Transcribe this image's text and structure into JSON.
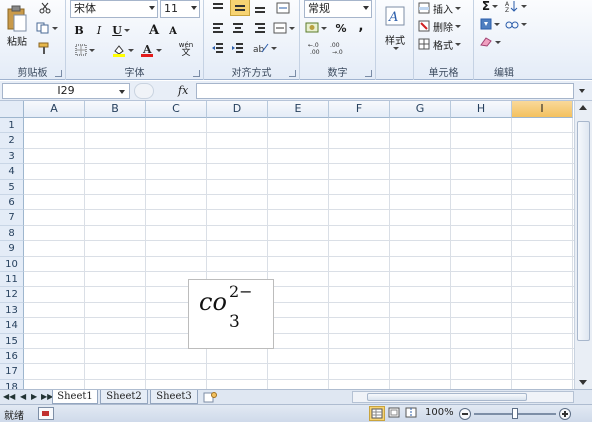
{
  "ribbon": {
    "clipboard": {
      "paste_label": "粘贴",
      "group_label": "剪贴板"
    },
    "font": {
      "font_name": "宋体",
      "font_size": "11",
      "bold": "B",
      "italic": "I",
      "underline": "U",
      "grow": "A",
      "shrink": "A",
      "wen": "wén",
      "wen2": "文",
      "group_label": "字体"
    },
    "alignment": {
      "group_label": "对齐方式"
    },
    "number": {
      "format": "常规",
      "percent": "%",
      "comma": ",",
      "group_label": "数字"
    },
    "styles": {
      "label": "样式"
    },
    "cells": {
      "insert": "插入",
      "delete": "删除",
      "format": "格式",
      "group_label": "单元格"
    },
    "editing": {
      "sigma": "Σ",
      "group_label": "编辑"
    }
  },
  "formula_bar": {
    "name_box": "I29",
    "fx": "fx"
  },
  "grid": {
    "columns": [
      "A",
      "B",
      "C",
      "D",
      "E",
      "F",
      "G",
      "H",
      "I"
    ],
    "selected_column": "I",
    "rows": [
      "1",
      "2",
      "3",
      "4",
      "5",
      "6",
      "7",
      "8",
      "9",
      "10",
      "11",
      "12",
      "13",
      "14",
      "15",
      "16",
      "17",
      "18"
    ]
  },
  "equation": {
    "base": "co",
    "subscript": "3",
    "superscript": "2−"
  },
  "sheet_tabs": [
    "Sheet1",
    "Sheet2",
    "Sheet3"
  ],
  "active_sheet": "Sheet1",
  "status": {
    "ready": "就绪",
    "zoom": "100%"
  },
  "icons": [
    "paste-icon",
    "cut-icon",
    "copy-icon",
    "format-painter-icon",
    "border-icon",
    "fill-color-icon",
    "font-color-icon",
    "styles-icon",
    "insert-icon",
    "delete-icon",
    "format-icon",
    "sort-icon",
    "find-icon",
    "fill-icon",
    "clear-icon",
    "insert-sheet-icon",
    "normal-view-icon",
    "page-layout-icon",
    "page-break-icon",
    "zoom-out-icon",
    "zoom-in-icon"
  ]
}
